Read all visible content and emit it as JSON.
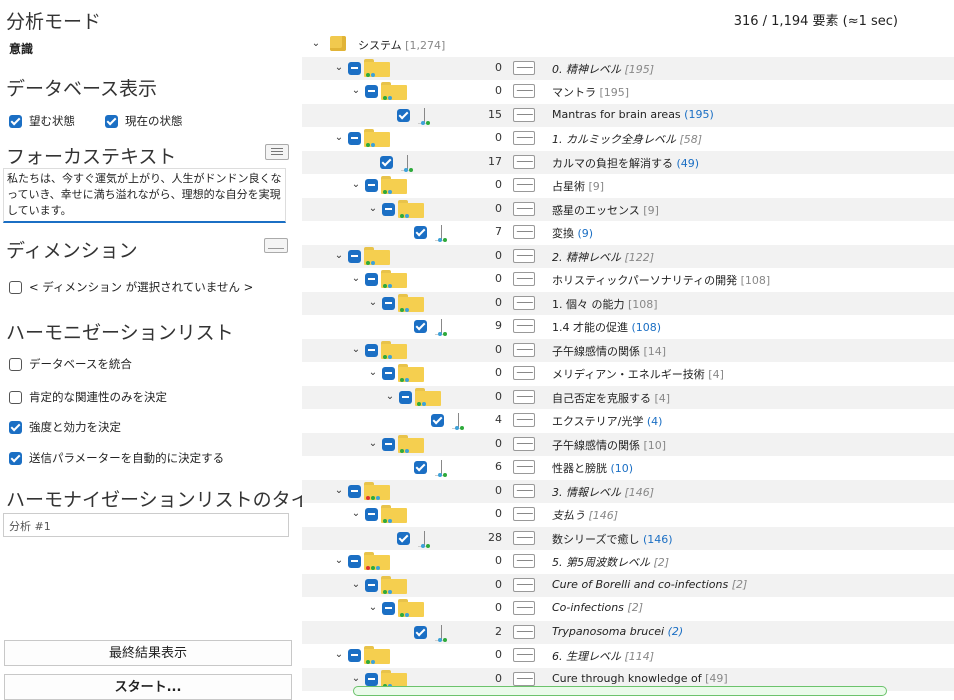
{
  "header": {
    "count_text": "316 / 1,194 要素 (≈1 sec)"
  },
  "left": {
    "analysis_mode_title": "分析モード",
    "analysis_mode_value": "意識",
    "db_display_title": "データベース表示",
    "db_desired_label": "望む状態",
    "db_current_label": "現在の状態",
    "focus_text_title": "フォーカステキスト",
    "focus_text_value": "私たちは、今すぐ運気が上がり、人生がドンドン良くなっていき、幸せに満ち溢れながら、理想的な自分を実現しています。",
    "dimension_title": "ディメンション",
    "dimension_none_label": "< ディメンション が選択されていません >",
    "harmonization_title": "ハーモニゼーションリスト",
    "opt_merge_db": "データベースを統合",
    "opt_positive_only": "肯定的な関連性のみを決定",
    "opt_strength": "強度と効力を決定",
    "opt_auto_params": "送信パラメーターを自動的に決定する",
    "list_title_heading": "ハーモナイゼーションリストのタイトル",
    "list_title_value": "分析 #1",
    "final_result_button": "最終結果表示",
    "start_button": "スタート..."
  },
  "tree": {
    "root_label": "システム",
    "root_count": "[1,274]",
    "rows": [
      {
        "label": "0. 精神レベル",
        "count": "[195]",
        "num": "0",
        "italic": true,
        "type": "folder"
      },
      {
        "label": "マントラ",
        "count": "[195]",
        "num": "0",
        "italic": false,
        "type": "folder"
      },
      {
        "label": "Mantras for brain areas",
        "count": "(195)",
        "num": "15",
        "italic": false,
        "type": "leaf"
      },
      {
        "label": "1. カルミック全身レベル",
        "count": "[58]",
        "num": "0",
        "italic": true,
        "type": "folder"
      },
      {
        "label": "カルマの負担を解消する",
        "count": "(49)",
        "num": "17",
        "italic": false,
        "type": "leaf"
      },
      {
        "label": "占星術",
        "count": "[9]",
        "num": "0",
        "italic": false,
        "type": "folder"
      },
      {
        "label": "惑星のエッセンス",
        "count": "[9]",
        "num": "0",
        "italic": false,
        "type": "folder"
      },
      {
        "label": "変換",
        "count": "(9)",
        "num": "7",
        "italic": false,
        "type": "leaf"
      },
      {
        "label": "2. 精神レベル",
        "count": "[122]",
        "num": "0",
        "italic": true,
        "type": "folder"
      },
      {
        "label": "ホリスティックパーソナリティの開発",
        "count": "[108]",
        "num": "0",
        "italic": false,
        "type": "folder"
      },
      {
        "label": "1. 個々 の能力",
        "count": "[108]",
        "num": "0",
        "italic": false,
        "type": "folder"
      },
      {
        "label": "1.4 才能の促進",
        "count": "(108)",
        "num": "9",
        "italic": false,
        "type": "leaf"
      },
      {
        "label": "子午線感情の関係",
        "count": "[14]",
        "num": "0",
        "italic": false,
        "type": "folder"
      },
      {
        "label": "メリディアン・エネルギー技術",
        "count": "[4]",
        "num": "0",
        "italic": false,
        "type": "folder"
      },
      {
        "label": "自己否定を克服する",
        "count": "[4]",
        "num": "0",
        "italic": false,
        "type": "folder"
      },
      {
        "label": "エクステリア/光学",
        "count": "(4)",
        "num": "4",
        "italic": false,
        "type": "leaf"
      },
      {
        "label": "子午線感情の関係",
        "count": "[10]",
        "num": "0",
        "italic": false,
        "type": "folder"
      },
      {
        "label": "性器と膀胱",
        "count": "(10)",
        "num": "6",
        "italic": false,
        "type": "leaf"
      },
      {
        "label": "3. 情報レベル",
        "count": "[146]",
        "num": "0",
        "italic": true,
        "type": "folder"
      },
      {
        "label": "支払う",
        "count": "[146]",
        "num": "0",
        "italic": true,
        "type": "folder"
      },
      {
        "label": "数シリーズで癒し",
        "count": "(146)",
        "num": "28",
        "italic": false,
        "type": "leaf"
      },
      {
        "label": "5. 第5周波数レベル",
        "count": "[2]",
        "num": "0",
        "italic": true,
        "type": "folder"
      },
      {
        "label": "Cure of Borelli and co-infections",
        "count": "[2]",
        "num": "0",
        "italic": true,
        "type": "folder"
      },
      {
        "label": "Co-infections",
        "count": "[2]",
        "num": "0",
        "italic": true,
        "type": "folder"
      },
      {
        "label": "Trypanosoma brucei",
        "count": "(2)",
        "num": "2",
        "italic": true,
        "type": "leaf"
      },
      {
        "label": "6. 生理レベル",
        "count": "[114]",
        "num": "0",
        "italic": true,
        "type": "folder"
      },
      {
        "label": "Cure through knowledge of",
        "count": "[49]",
        "num": "0",
        "italic": false,
        "type": "folder"
      }
    ]
  },
  "colors": {
    "accent": "#1b6fc4",
    "folder": "#f5cf4f",
    "dot_green": "#2eaa3c",
    "dot_blue": "#3ea2d9",
    "dot_red": "#d33"
  }
}
